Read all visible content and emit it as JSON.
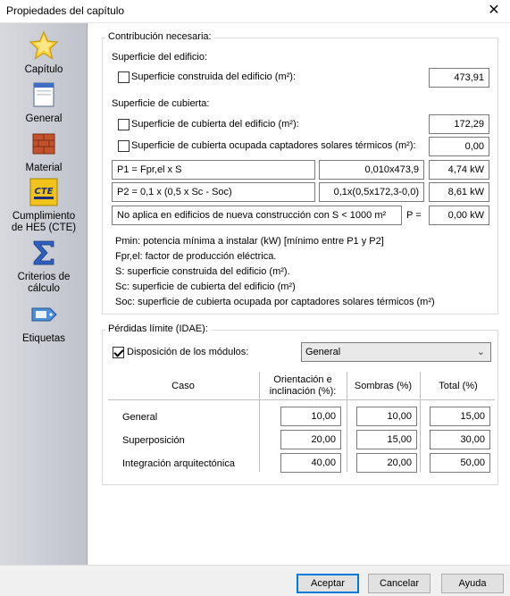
{
  "window": {
    "title": "Propiedades del capítulo",
    "close_symbol": "✕"
  },
  "sidebar": {
    "items": [
      {
        "label": "Capítulo",
        "icon": "star-icon"
      },
      {
        "label": "General",
        "icon": "window-icon"
      },
      {
        "label": "Material",
        "icon": "brick-icon"
      },
      {
        "label": "Cumplimiento de HE5 (CTE)",
        "line1": "Cumplimiento",
        "line2": "de HE5 (CTE)",
        "icon": "cte-icon",
        "badge": "CTE"
      },
      {
        "label": "Criterios de cálculo",
        "line1": "Criterios de",
        "line2": "cálculo",
        "icon": "sigma-icon"
      },
      {
        "label": "Etiquetas",
        "icon": "tag-icon"
      }
    ]
  },
  "contribucion": {
    "title": "Contribución necesaria:",
    "superficie_edificio_heading": "Superficie del edificio:",
    "construida": {
      "label": "Superficie construida del edificio (m²):",
      "value": "473,91",
      "checked": false
    },
    "superficie_cubierta_heading": "Superficie de cubierta:",
    "cubierta": {
      "label": "Superficie de cubierta del edificio (m²):",
      "value": "172,29",
      "checked": false
    },
    "ocupada": {
      "label": "Superficie de cubierta ocupada captadores solares térmicos (m²):",
      "value": "0,00",
      "checked": false
    },
    "p1": {
      "formula": "P1 = Fpr,el x S",
      "calc": "0,010x473,9",
      "result": "4,74 kW"
    },
    "p2": {
      "formula": "P2 = 0,1 x (0,5 x Sc - Soc)",
      "calc": "0,1x(0,5x172,3-0,0)",
      "result": "8,61 kW"
    },
    "p_final": {
      "note": "No aplica en edificios de nueva construcción con S < 1000 m²",
      "label": "P =",
      "value": "0,00 kW"
    },
    "legend": [
      "Pmin: potencia mínima a instalar (kW) [mínimo entre P1 y P2]",
      "Fpr,el: factor de producción eléctrica.",
      "S: superficie construida del edificio (m²).",
      "Sc: superficie de cubierta del edificio (m²)",
      "Soc: superficie de cubierta ocupada por captadores solares térmicos (m²)"
    ]
  },
  "perdidas": {
    "title": "Pérdidas límite (IDAE):",
    "disposicion": {
      "label": "Disposición de los módulos:",
      "checked": true,
      "selected": "General"
    },
    "headers": {
      "caso": "Caso",
      "orientacion_1": "Orientación e",
      "orientacion_2": "inclinación (%):",
      "sombras": "Sombras (%)",
      "total": "Total (%)"
    },
    "rows": [
      {
        "caso": "General",
        "orientacion": "10,00",
        "sombras": "10,00",
        "total": "15,00"
      },
      {
        "caso": "Superposición",
        "orientacion": "20,00",
        "sombras": "15,00",
        "total": "30,00"
      },
      {
        "caso": "Integración arquitectónica",
        "orientacion": "40,00",
        "sombras": "20,00",
        "total": "50,00"
      }
    ]
  },
  "footer": {
    "accept": "Aceptar",
    "cancel": "Cancelar",
    "help": "Ayuda"
  }
}
